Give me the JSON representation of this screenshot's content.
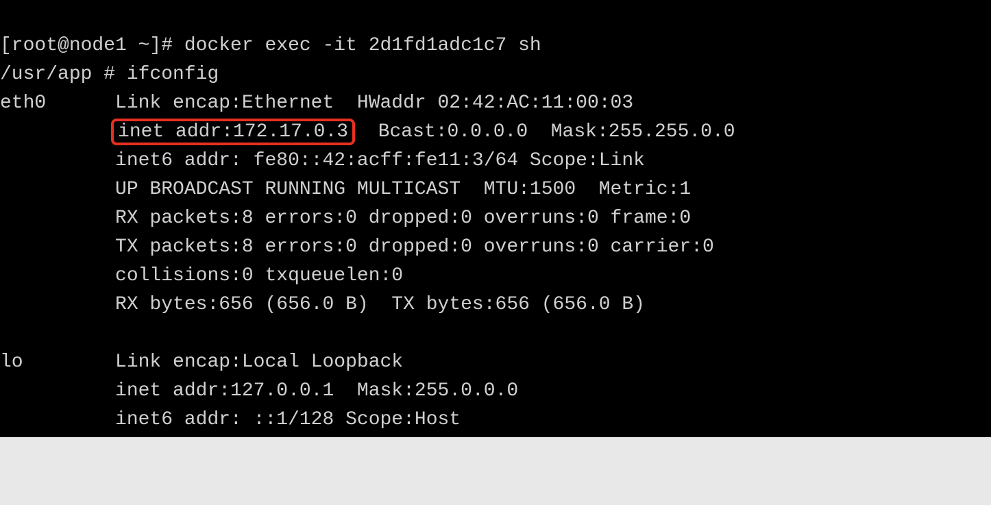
{
  "lines": {
    "l1": "[root@node1 ~]# docker exec -it 2d1fd1adc1c7 sh",
    "l2": "/usr/app # ifconfig",
    "l3": "eth0      Link encap:Ethernet  HWaddr 02:42:AC:11:00:03",
    "l4_indent": "          ",
    "l4_highlight": "inet addr:172.17.0.3",
    "l4_rest": "  Bcast:0.0.0.0  Mask:255.255.0.0",
    "l5": "          inet6 addr: fe80::42:acff:fe11:3/64 Scope:Link",
    "l6": "          UP BROADCAST RUNNING MULTICAST  MTU:1500  Metric:1",
    "l7": "          RX packets:8 errors:0 dropped:0 overruns:0 frame:0",
    "l8": "          TX packets:8 errors:0 dropped:0 overruns:0 carrier:0",
    "l9": "          collisions:0 txqueuelen:0",
    "l10": "          RX bytes:656 (656.0 B)  TX bytes:656 (656.0 B)",
    "l11": "",
    "l12": "lo        Link encap:Local Loopback",
    "l13": "          inet addr:127.0.0.1  Mask:255.0.0.0",
    "l14": "          inet6 addr: ::1/128 Scope:Host"
  }
}
